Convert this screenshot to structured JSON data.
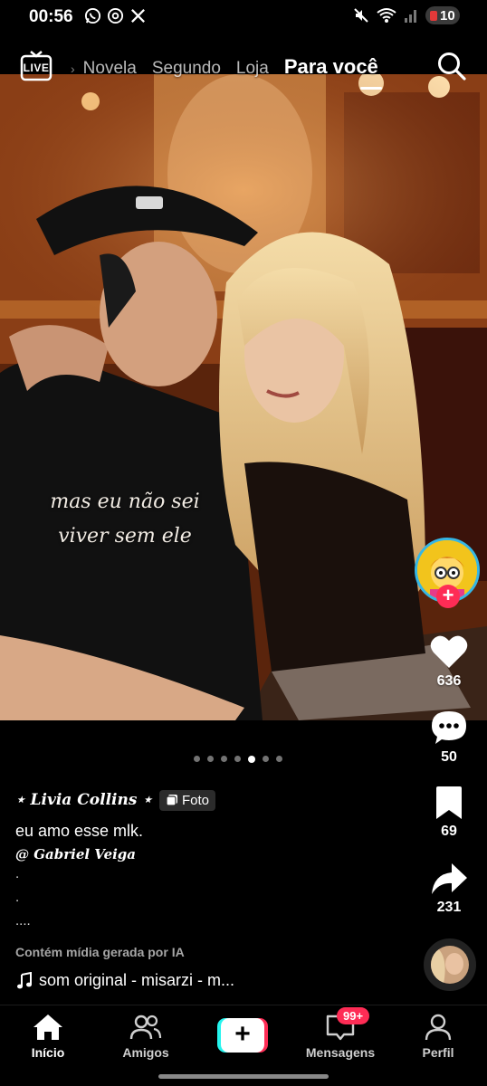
{
  "status_bar": {
    "time": "00:56",
    "battery": "10",
    "left_icons": [
      "whatsapp-icon",
      "threads-icon",
      "x-icon"
    ],
    "right_icons": [
      "mute-icon",
      "wifi-icon",
      "signal-icon"
    ]
  },
  "top_nav": {
    "live_label": "LIVE",
    "tabs": [
      {
        "label": "Novela",
        "active": false
      },
      {
        "label": "Segundo",
        "active": false
      },
      {
        "label": "Loja",
        "active": false
      },
      {
        "label": "Para você",
        "active": true
      }
    ]
  },
  "photo": {
    "overlay_line1": "mas eu não sei",
    "overlay_line2": "viver sem ele",
    "carousel_total": 7,
    "carousel_active": 5
  },
  "actions": {
    "likes": "636",
    "comments": "50",
    "saves": "69",
    "shares": "231"
  },
  "caption": {
    "author": "⋆ Livia Collins ⋆",
    "badge": "Foto",
    "text": "eu amo esse mlk.",
    "mention": "@ Gabriel Veiga",
    "dots": [
      ".",
      ".",
      "...."
    ],
    "ai_note": "Contém mídia gerada por IA",
    "sound": "som original - misarzi - m..."
  },
  "bottom_nav": {
    "items": [
      "Início",
      "Amigos",
      "Mensagens",
      "Perfil"
    ],
    "messages_badge": "99+"
  },
  "colors": {
    "accent_red": "#fe2c55",
    "accent_cyan": "#25f4ee",
    "ring_blue": "#35b6e5"
  }
}
